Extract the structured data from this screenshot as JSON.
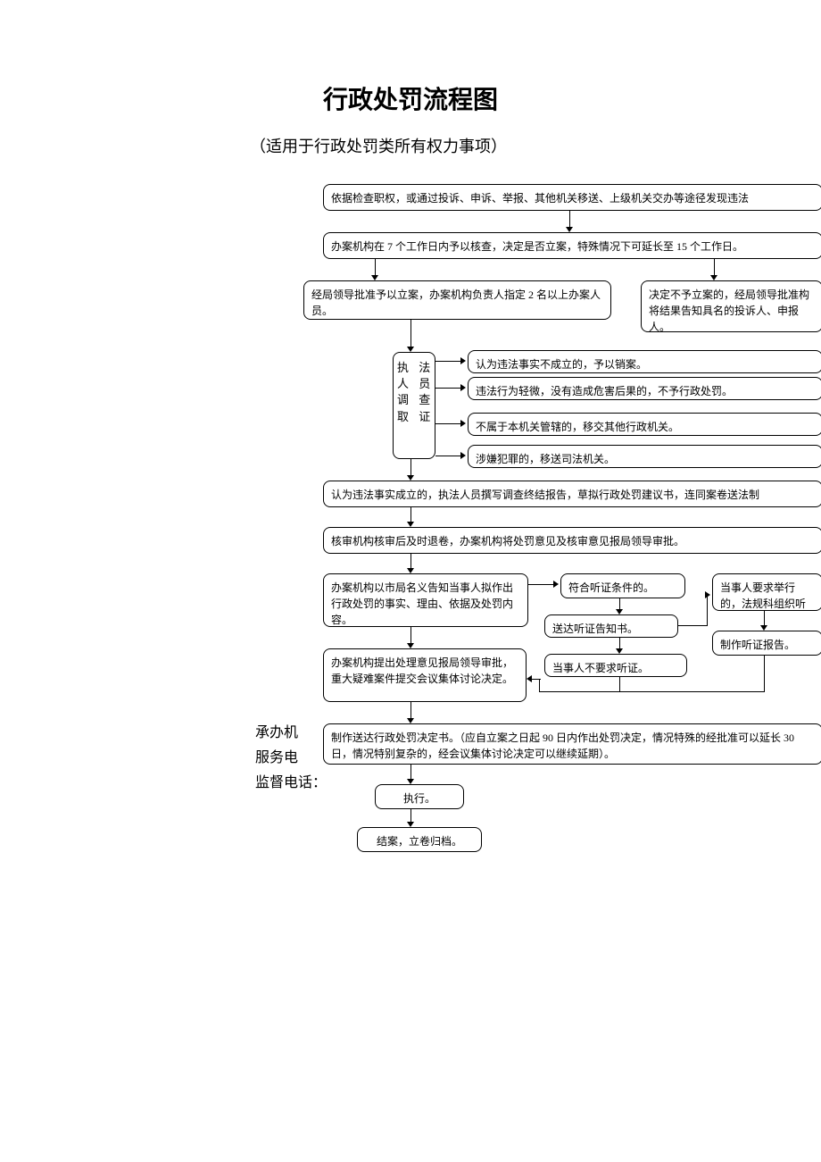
{
  "title": "行政处罚流程图",
  "subtitle": "（适用于行政处罚类所有权力事项）",
  "boxes": {
    "b1": "依据检查职权，或通过投诉、申诉、举报、其他机关移送、上级机关交办等途径发现违法",
    "b2": "办案机构在 7 个工作日内予以核查，决定是否立案，特殊情况下可延长至 15 个工作日。",
    "b3": "经局领导批准予以立案，办案机构负责人指定 2 名以上办案人员。",
    "b4": "决定不予立案的，经局领导批准构将结果告知具名的投诉人、申报人。",
    "b5": "执 法\n人 员\n调 查\n取 证",
    "b6": "认为违法事实不成立的，予以销案。",
    "b7": "违法行为轻微，没有造成危害后果的，不予行政处罚。",
    "b8": "不属于本机关管辖的，移交其他行政机关。",
    "b9": "涉嫌犯罪的，移送司法机关。",
    "b10": "认为违法事实成立的，执法人员撰写调查终结报告，草拟行政处罚建议书，连同案卷送法制",
    "b11": "核审机构核审后及时退卷，办案机构将处罚意见及核审意见报局领导审批。",
    "b12": "办案机构以市局名义告知当事人拟作出行政处罚的事实、理由、依据及处罚内容。",
    "b13": "符合听证条件的。",
    "b14": "送达听证告知书。",
    "b15": "当事人不要求听证。",
    "b16": "当事人要求举行的，法规科组织听",
    "b17": "制作听证报告。",
    "b18": "办案机构提出处理意见报局领导审批，重大疑难案件提交会议集体讨论决定。",
    "b19": "制作送达行政处罚决定书。（应自立案之日起 90 日内作出处罚决定，情况特殊的经批准可以延长 30 日，情况特别复杂的，经会议集体讨论决定可以继续延期）。",
    "b20": "执行。",
    "b21": "结案，立卷归档。"
  },
  "footer": {
    "f1": "承办机",
    "f2": "服务电",
    "f3": "监督电话："
  }
}
